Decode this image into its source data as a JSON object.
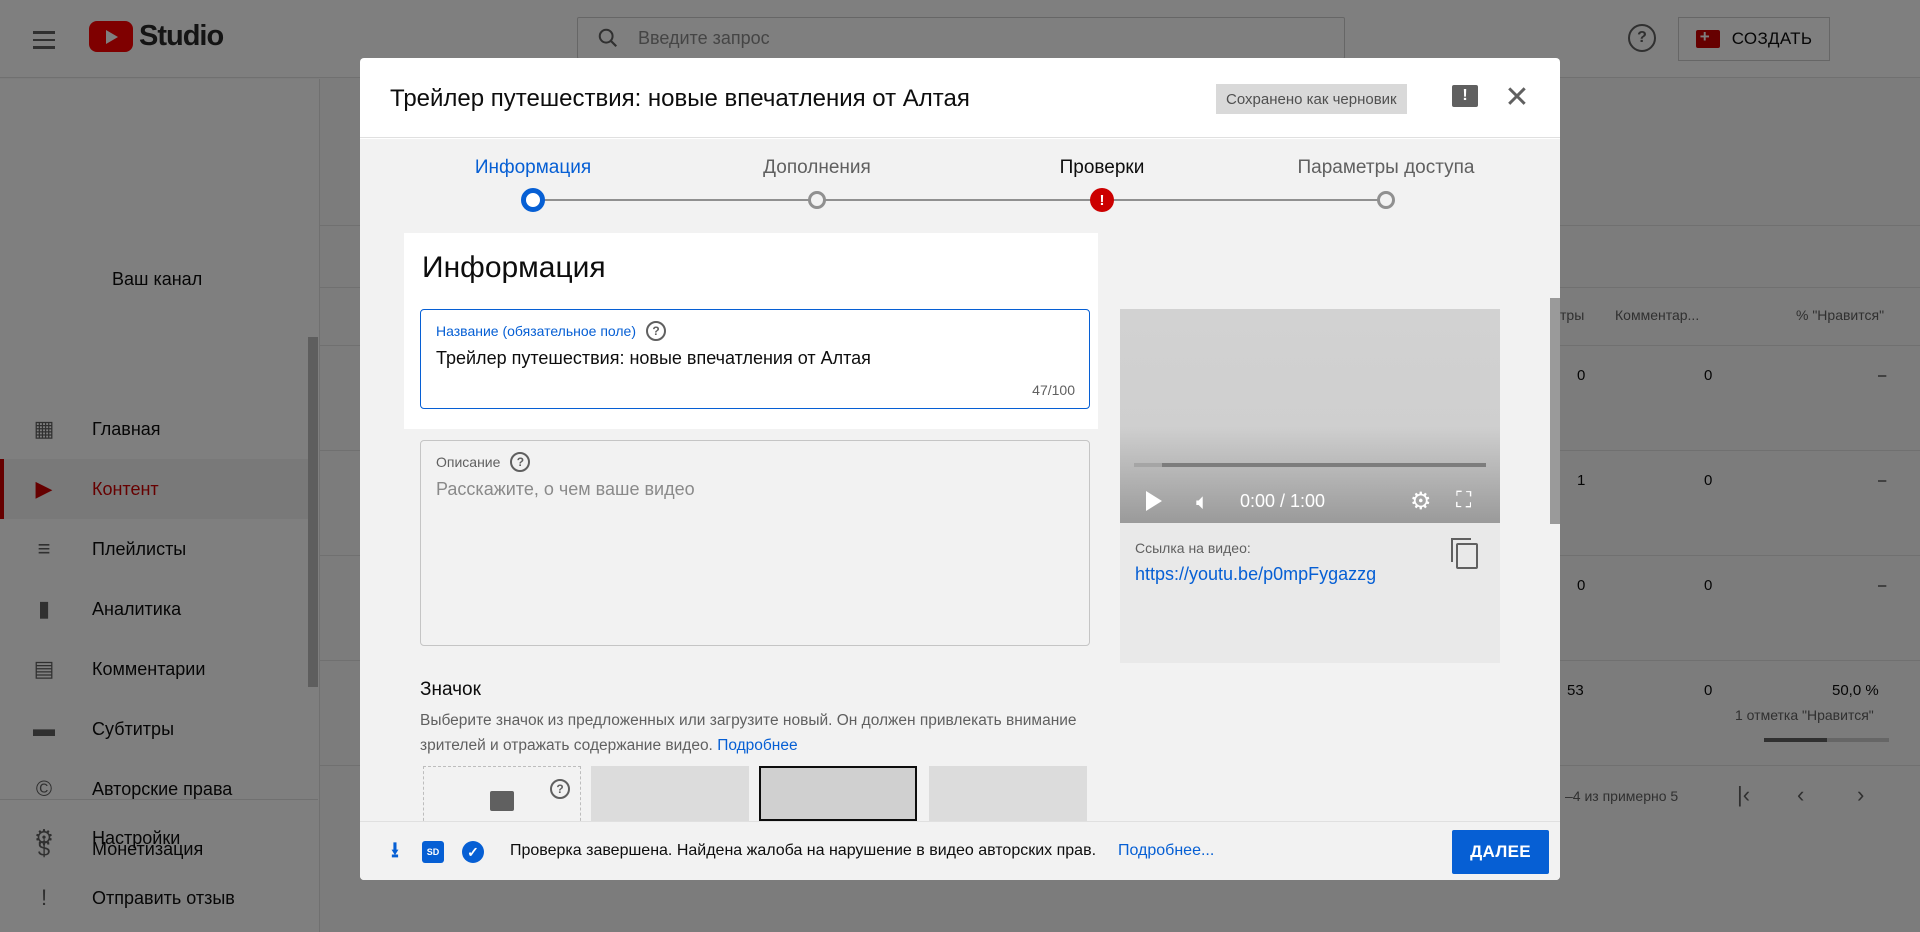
{
  "topbar": {
    "logo_text": "Studio",
    "search_placeholder": "Введите запрос",
    "help_label": "?",
    "create_label": "СОЗДАТЬ"
  },
  "sidebar": {
    "channel_label": "Ваш канал",
    "items": [
      {
        "label": "Главная",
        "icon": "dashboard-icon",
        "glyph": "▦"
      },
      {
        "label": "Контент",
        "icon": "video-content-icon",
        "glyph": "▶",
        "active": true
      },
      {
        "label": "Плейлисты",
        "icon": "playlist-icon",
        "glyph": "≡"
      },
      {
        "label": "Аналитика",
        "icon": "analytics-icon",
        "glyph": "▮"
      },
      {
        "label": "Комментарии",
        "icon": "comments-icon",
        "glyph": "▤"
      },
      {
        "label": "Субтитры",
        "icon": "subtitles-icon",
        "glyph": "▬"
      },
      {
        "label": "Авторские права",
        "icon": "copyright-icon",
        "glyph": "©"
      },
      {
        "label": "Монетизация",
        "icon": "dollar-icon",
        "glyph": "$"
      }
    ],
    "bottom_items": [
      {
        "label": "Настройки",
        "icon": "gear-icon",
        "glyph": "⚙"
      },
      {
        "label": "Отправить отзыв",
        "icon": "feedback-icon",
        "glyph": "!"
      }
    ]
  },
  "background_table": {
    "headers": [
      "тры",
      "Комментар...",
      "% \"Нравится\""
    ],
    "rows": [
      {
        "views": "0",
        "comments": "0",
        "likes": "–"
      },
      {
        "views": "1",
        "comments": "0",
        "likes": "–"
      },
      {
        "views": "0",
        "comments": "0",
        "likes": "–"
      },
      {
        "views": "53",
        "comments": "0",
        "likes": "50,0 %",
        "likes_note": "1 отметка \"Нравится\""
      }
    ],
    "pagination": "–4 из примерно 5",
    "like_ratio": 0.5
  },
  "dialog": {
    "title": "Трейлер путешествия: новые впечатления от Алтая",
    "draft_badge": "Сохранено как черновик",
    "steps": [
      {
        "label": "Информация",
        "state": "active"
      },
      {
        "label": "Дополнения",
        "state": "todo"
      },
      {
        "label": "Проверки",
        "state": "warning"
      },
      {
        "label": "Параметры доступа",
        "state": "todo"
      }
    ],
    "section_title": "Информация",
    "title_field": {
      "label": "Название (обязательное поле)",
      "value": "Трейлер путешествия: новые впечатления от Алтая",
      "counter": "47/100"
    },
    "description_field": {
      "label": "Описание",
      "placeholder": "Расскажите, о чем ваше видео"
    },
    "video": {
      "time": "0:00 / 1:00",
      "link_label": "Ссылка на видео:",
      "link_url": "https://youtu.be/p0mpFygazzg"
    },
    "thumbnail": {
      "title": "Значок",
      "description": "Выберите значок из предложенных или загрузите новый. Он должен привлекать внимание зрителей и отражать содержание видео.",
      "more_link": "Подробнее"
    },
    "footer": {
      "status_text": "Проверка завершена. Найдена жалоба на нарушение в видео авторских прав.",
      "more_link": "Подробнее...",
      "next_label": "ДАЛЕЕ"
    }
  }
}
